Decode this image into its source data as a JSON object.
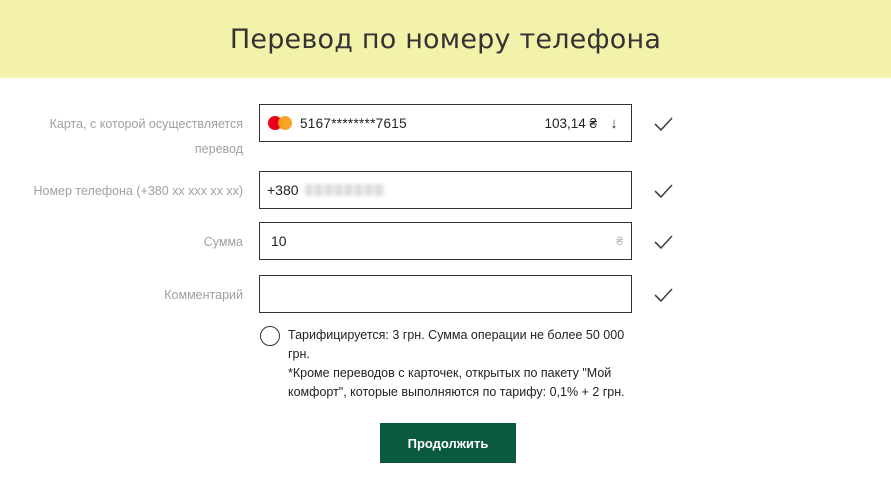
{
  "header": {
    "title": "Перевод по номеру телефона"
  },
  "form": {
    "card": {
      "label": "Карта, с которой осуществляется перевод",
      "brand_icon": "mastercard-icon",
      "number": "5167********7615",
      "balance": "103,14 ₴",
      "toggle_icon": "arrow-down-icon"
    },
    "phone": {
      "label": "Номер телефона (+380 xx xxx xx xx)",
      "prefix": "+380"
    },
    "amount": {
      "label": "Сумма",
      "value": "10",
      "currency": "₴"
    },
    "comment": {
      "label": "Комментарий",
      "value": ""
    },
    "fee_note": {
      "line1": "Тарифицируется: 3 грн. Сумма операции не более 50 000 грн.",
      "line2": "*Кроме переводов с карточек, открытых по пакету \"Мой комфорт\", которые выполняются по тарифу: 0,1% + 2 грн."
    },
    "submit_label": "Продолжить"
  },
  "colors": {
    "header_bg": "#f2f2ab",
    "button_bg": "#0b5a3d",
    "label_text": "#a0a0a0"
  }
}
